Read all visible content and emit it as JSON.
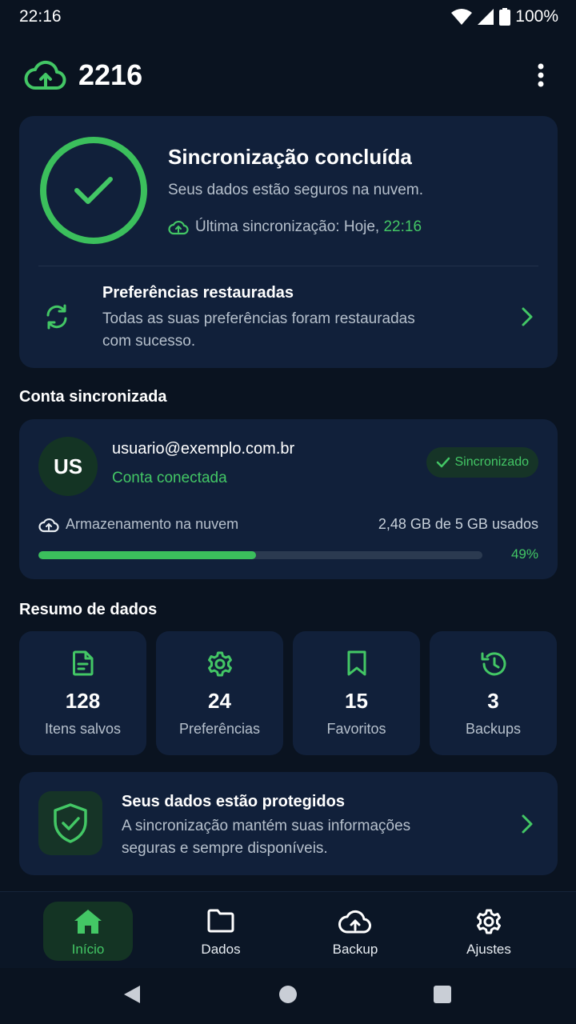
{
  "status_bar": {
    "time": "22:16",
    "battery": "100%"
  },
  "header": {
    "title": "2216",
    "logo_icon": "cloud-upload-icon",
    "menu_icon": "more-vert-icon"
  },
  "sync": {
    "title": "Sincronização concluída",
    "subtitle": "Seus dados estão seguros na nuvem.",
    "last_sync_label": "Última sincronização: Hoje, ",
    "last_sync_time": "22:16",
    "pref_title": "Preferências restauradas",
    "pref_desc": "Todas as suas preferências foram restauradas com sucesso."
  },
  "account": {
    "section_title": "Conta sincronizada",
    "initials": "US",
    "email": "usuario@exemplo.com.br",
    "status": "Conta conectada",
    "badge": "Sincronizado",
    "storage_label": "Armazenamento na nuvem",
    "storage_usage": "2,48 GB de 5 GB usados",
    "storage_percent_label": "49%",
    "storage_fraction": 0.49
  },
  "summary": {
    "section_title": "Resumo de dados",
    "items": [
      {
        "icon": "file-icon",
        "value": "128",
        "label": "Itens salvos"
      },
      {
        "icon": "gear-icon",
        "value": "24",
        "label": "Preferências"
      },
      {
        "icon": "bookmark-icon",
        "value": "15",
        "label": "Favoritos"
      },
      {
        "icon": "history-icon",
        "value": "3",
        "label": "Backups"
      }
    ]
  },
  "protect": {
    "title": "Seus dados estão protegidos",
    "desc": "A sincronização mantém suas informações seguras e sempre disponíveis."
  },
  "nav": {
    "items": [
      {
        "label": "Início",
        "icon": "home-icon",
        "active": true
      },
      {
        "label": "Dados",
        "icon": "folder-icon",
        "active": false
      },
      {
        "label": "Backup",
        "icon": "cloud-upload-icon",
        "active": false
      },
      {
        "label": "Ajustes",
        "icon": "gear-icon",
        "active": false
      }
    ]
  },
  "colors": {
    "accent": "#43c765",
    "background": "#0a1320",
    "card": "#11203a"
  }
}
